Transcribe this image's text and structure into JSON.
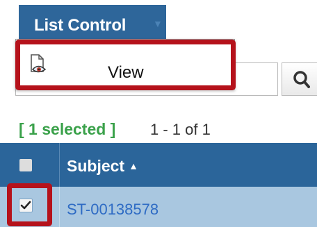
{
  "tab": {
    "label": "List Control"
  },
  "menu": {
    "view_label": "View"
  },
  "status": {
    "selected": "[ 1 selected ]",
    "range": "1 - 1 of 1"
  },
  "table": {
    "columns": [
      {
        "label": "Subject"
      }
    ],
    "rows": [
      {
        "subject": "ST-00138578",
        "checked": true
      }
    ]
  },
  "colors": {
    "header_bg": "#2b659a",
    "selected_row_bg": "#a9c7e0",
    "highlight": "#b5121b",
    "selected_text": "#3aa14a",
    "link": "#2e6bc4"
  },
  "icons": {
    "view": "document-eye-icon",
    "search": "magnifier-icon",
    "sort": "sort-ascending-icon"
  }
}
